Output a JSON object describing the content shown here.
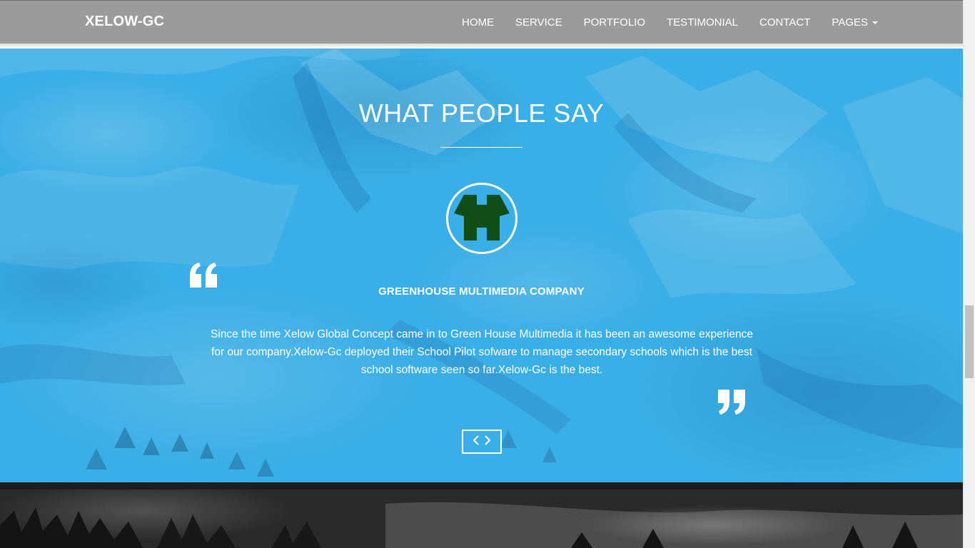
{
  "navbar": {
    "brand": "XELOW-GC",
    "items": [
      {
        "label": "HOME"
      },
      {
        "label": "SERVICE"
      },
      {
        "label": "PORTFOLIO"
      },
      {
        "label": "TESTIMONIAL"
      },
      {
        "label": "CONTACT"
      },
      {
        "label": "PAGES"
      }
    ]
  },
  "testimonial": {
    "title": "WHAT PEOPLE SAY",
    "client_name": "GREENHOUSE MULTIMEDIA COMPANY",
    "quote": "Since the time Xelow Global Concept came in to Green House Multimedia it has been an awesome experience for our company.Xelow-Gc deployed their School Pilot sofware to manage secondary schools which is the best school software seen so far.Xelow-Gc is the best.",
    "prev_icon": "chevron-left-icon",
    "next_icon": "chevron-right-icon",
    "open_quote_icon": "quote-open-icon",
    "close_quote_icon": "quote-close-icon",
    "avatar_icon": "greenhouse-logo-icon"
  },
  "colors": {
    "navbar_bg": "#9b9b9b",
    "section_bg": "#3aaee6",
    "logo_green": "#0f4d16",
    "text": "#ffffff",
    "dark_section_bg": "#2a2a2a"
  }
}
